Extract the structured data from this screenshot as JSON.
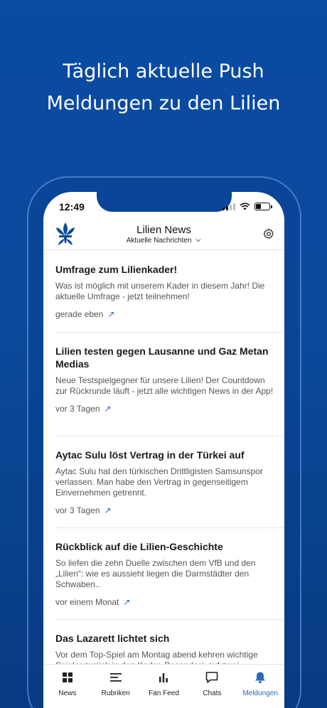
{
  "headline": {
    "line1": "Täglich aktuelle Push",
    "line2": "Meldungen zu den Lilien"
  },
  "status_bar": {
    "time": "12:49"
  },
  "header": {
    "title": "Lilien News",
    "subtitle": "Aktuelle Nachrichten",
    "logo_icon": "lily-crest-icon",
    "settings_icon": "gear-icon"
  },
  "feed": [
    {
      "title": "Umfrage zum Lilienkader!",
      "body": "Was ist möglich mit unserem Kader in diesem Jahr! Die aktuelle Umfrage - jetzt teilnehmen!",
      "time": "gerade eben"
    },
    {
      "title": "Lilien testen gegen Lausanne und Gaz Metan Medias",
      "body": "Neue Testspielgegner für unsere Lilien! Der Countdown zur Rückrunde läuft - jetzt alle wichtigen News in der App!",
      "time": "vor 3 Tagen"
    },
    {
      "title": "Aytac Sulu löst Vertrag in der Türkei auf",
      "body": "Aytac Sulu hat den türkischen Drittligisten Samsunspor verlassen. Man habe den Vertrag in gegenseitigem Einvernehmen getrennt.",
      "time": "vor 3 Tagen"
    },
    {
      "title": "Rückblick auf die Lilien-Geschichte",
      "body": "So liefen die zehn Duelle zwischen dem VfB und den „Lilien“: wie es aussieht liegen die Darmstädter den Schwaben..",
      "time": "vor einem Monat"
    },
    {
      "title": "Das Lazarett lichtet sich",
      "body": "Vor dem Top-Spiel am Montag abend kehren wichtige Spieler zurück in den Kader. Besonders auf zwei",
      "time": ""
    }
  ],
  "tabs": [
    {
      "label": "News",
      "icon": "grid-icon"
    },
    {
      "label": "Rubriken",
      "icon": "list-icon"
    },
    {
      "label": "Fan Feed",
      "icon": "bar-chart-icon"
    },
    {
      "label": "Chats",
      "icon": "chat-bubble-icon"
    },
    {
      "label": "Meldungen",
      "icon": "bell-icon"
    }
  ],
  "active_tab": "Meldungen",
  "colors": {
    "brand_blue": "#0b4a9c",
    "accent": "#2a69b8"
  }
}
